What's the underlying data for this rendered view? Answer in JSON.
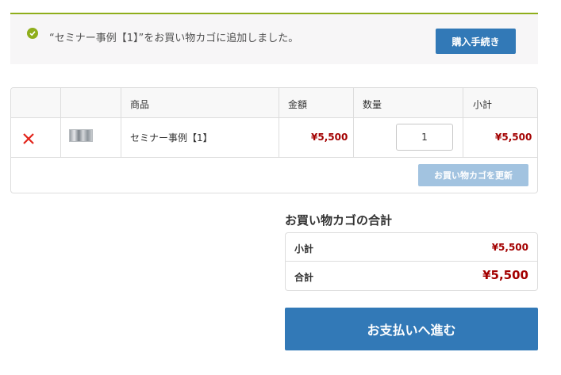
{
  "notice": {
    "message": "“セミナー事例【1】”をお買い物カゴに追加しました。",
    "button_label": "購入手続き",
    "accent_color": "#8fae1b",
    "icon": "check-circle-icon"
  },
  "cart": {
    "headers": [
      "",
      "",
      "商品",
      "金額",
      "数量",
      "小計"
    ],
    "items": [
      {
        "remove_icon": "close-icon",
        "name": "セミナー事例【1】",
        "price": "¥5,500",
        "quantity": "1",
        "subtotal": "¥5,500"
      }
    ],
    "update_button_label": "お買い物カゴを更新"
  },
  "totals": {
    "title": "お買い物カゴの合計",
    "subtotal_label": "小計",
    "subtotal_value": "¥5,500",
    "total_label": "合計",
    "total_value": "¥5,500"
  },
  "proceed_button_label": "お支払いへ進む",
  "colors": {
    "primary": "#3279b7",
    "primary_disabled": "#a2c3e0",
    "price": "#a30000"
  }
}
